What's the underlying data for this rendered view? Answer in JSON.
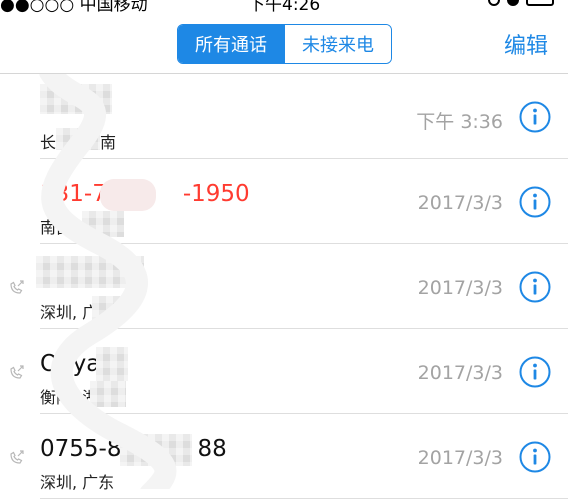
{
  "status_bar": {
    "carrier": "●●○○○ 中国移动",
    "time": "下午4:26"
  },
  "nav": {
    "segments": [
      {
        "label": "所有通话",
        "active": true
      },
      {
        "label": "未接来电",
        "active": false
      }
    ],
    "edit_label": "编辑"
  },
  "calls": [
    {
      "name": "",
      "location": "长沙, 湖南",
      "location_visible": "长",
      "location_tail": "南",
      "time": "下午 3:36",
      "missed": false,
      "outgoing": false
    },
    {
      "name_head": "131-7",
      "name_tail": "-1950",
      "location_visible": "南昌, 江",
      "time": "2017/3/3",
      "missed": true,
      "outgoing": false
    },
    {
      "name": "",
      "location_visible": "深圳, 广",
      "time": "2017/3/3",
      "missed": false,
      "outgoing": true
    },
    {
      "name_head": "Ouya",
      "location_visible": "衡阳, 湖",
      "time": "2017/3/3",
      "missed": false,
      "outgoing": true
    },
    {
      "name_head": "0755-8",
      "name_tail": "88",
      "location_visible": "深圳, 广东",
      "time": "2017/3/3",
      "missed": false,
      "outgoing": true
    }
  ],
  "colors": {
    "accent": "#1e88e5",
    "missed": "#ff3b30",
    "secondary_text": "#a3a3a3"
  },
  "icons": {
    "info": "info-circle-icon",
    "outgoing": "outgoing-call-icon"
  }
}
